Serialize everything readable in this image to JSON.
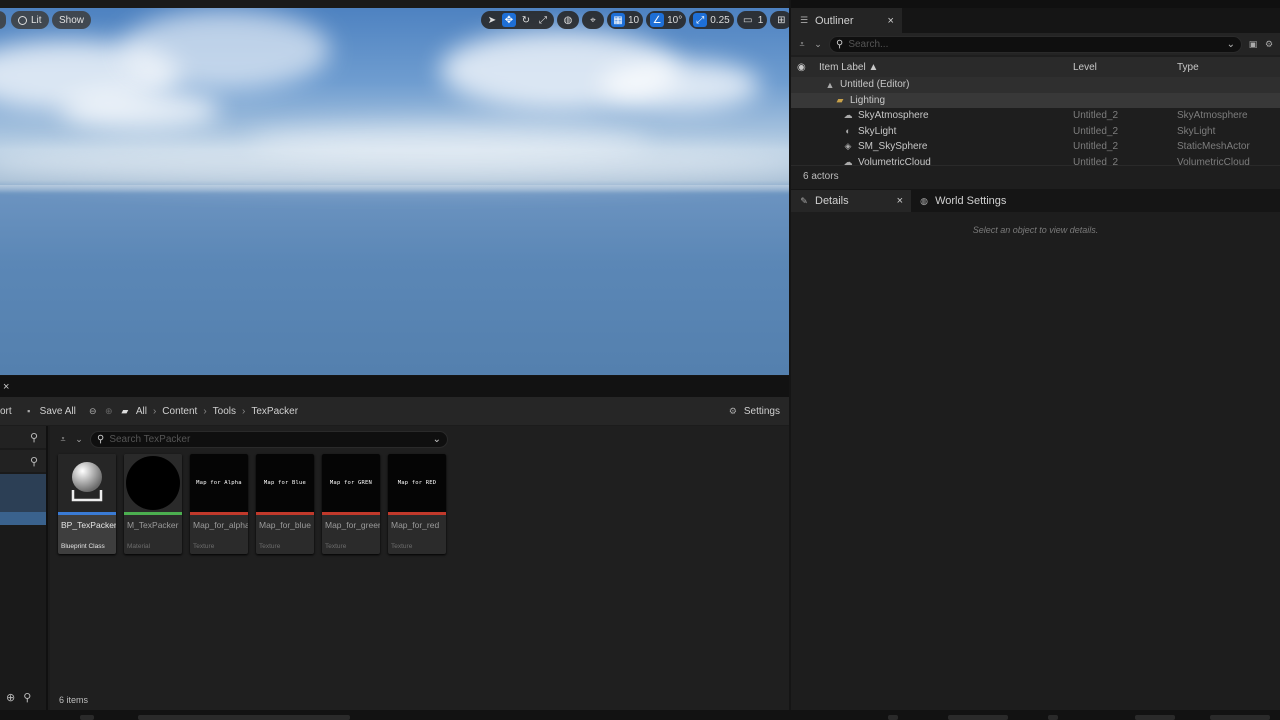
{
  "viewport": {
    "lit_label": "Lit",
    "show_label": "Show",
    "grid_value": "10",
    "angle_value": "10°",
    "scale_value": "0.25",
    "camera_value": "1"
  },
  "outliner": {
    "tab_label": "Outliner",
    "tab_close": "×",
    "search_placeholder": "Search...",
    "columns": [
      "Item Label ▲",
      "Level",
      "Type"
    ],
    "rows": [
      {
        "label": "Untitled (Editor)",
        "level": "",
        "type": "",
        "kind": "root"
      },
      {
        "label": "Lighting",
        "level": "",
        "type": "",
        "kind": "folder"
      },
      {
        "label": "SkyAtmosphere",
        "level": "Untitled_2",
        "type": "SkyAtmosphere",
        "kind": "actor"
      },
      {
        "label": "SkyLight",
        "level": "Untitled_2",
        "type": "SkyLight",
        "kind": "actor"
      },
      {
        "label": "SM_SkySphere",
        "level": "Untitled_2",
        "type": "StaticMeshActor",
        "kind": "actor"
      },
      {
        "label": "VolumetricCloud",
        "level": "Untitled_2",
        "type": "VolumetricCloud",
        "kind": "actor"
      }
    ],
    "footer": "6 actors"
  },
  "details": {
    "tab_label": "Details",
    "tab_close": "×",
    "world_settings_label": "World Settings",
    "empty_message": "Select an object to view details."
  },
  "content_browser": {
    "tab_close": "×",
    "import_label": "ort",
    "save_all_label": "Save All",
    "breadcrumb": [
      "All",
      "Content",
      "Tools",
      "TexPacker"
    ],
    "settings_label": "Settings",
    "search_placeholder": "Search TexPacker",
    "assets": [
      {
        "name": "BP_TexPacker",
        "type": "Blueprint Class",
        "thumb_text": "",
        "bar_color": "#3a7bd5"
      },
      {
        "name": "M_TexPacker",
        "type": "Material",
        "thumb_text": "",
        "bar_color": "#4caf50"
      },
      {
        "name": "Map_for_alpha",
        "type": "Texture",
        "thumb_text": "Map for Alpha",
        "bar_color": "#c0392b"
      },
      {
        "name": "Map_for_blue",
        "type": "Texture",
        "thumb_text": "Map for Blue",
        "bar_color": "#c0392b"
      },
      {
        "name": "Map_for_green",
        "type": "Texture",
        "thumb_text": "Map for GREN",
        "bar_color": "#c0392b"
      },
      {
        "name": "Map_for_red",
        "type": "Texture",
        "thumb_text": "Map for RED",
        "bar_color": "#c0392b"
      }
    ],
    "status": "6 items"
  }
}
